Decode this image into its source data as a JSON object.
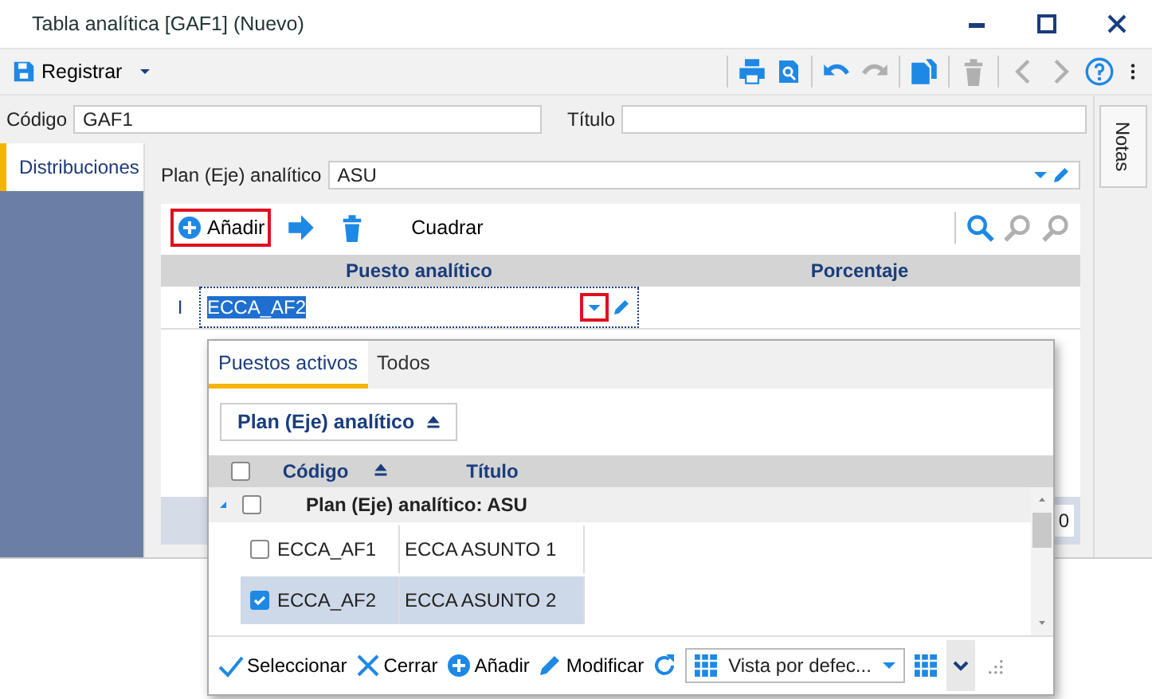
{
  "window": {
    "title": "Tabla analítica [GAF1] (Nuevo)"
  },
  "toolbar": {
    "save_label": "Registrar"
  },
  "header_fields": [
    {
      "label": "Código",
      "value": "GAF1"
    },
    {
      "label": "Título"
    }
  ],
  "side_tabs": [
    {
      "label": "Distribuciones",
      "selected": true
    }
  ],
  "notes_tab": {
    "label": "Notas"
  },
  "plan_field": {
    "label": "Plan (Eje) analítico",
    "value": "ASU"
  },
  "grid_toolbar": [
    {
      "kind": "add",
      "label": "Añadir",
      "highlighted": true
    },
    {
      "kind": "move",
      "highlighted": false
    },
    {
      "kind": "delete",
      "highlighted": false
    },
    {
      "kind": "text",
      "label": "Cuadrar",
      "highlighted": false
    }
  ],
  "grid": {
    "columns": [
      "Puesto analítico",
      "Porcentaje"
    ],
    "editing_row": {
      "marker": "I",
      "value": "ECCA_AF2",
      "dropdown_highlighted": true
    },
    "total": "0"
  },
  "popup": {
    "tabs": [
      {
        "label": "Puestos activos",
        "selected": true
      },
      {
        "label": "Todos",
        "selected": false
      }
    ],
    "group_by": "Plan (Eje) analítico",
    "select_all_checked": false,
    "columns": [
      {
        "label": "Código",
        "sorted": true
      },
      {
        "label": "Título",
        "sorted": false
      }
    ],
    "groups": [
      {
        "label": "Plan (Eje) analítico: ASU",
        "expanded": true,
        "checked": false,
        "rows": [
          {
            "code": "ECCA_AF1",
            "title": "ECCA ASUNTO 1",
            "checked": false,
            "selected": false
          },
          {
            "code": "ECCA_AF2",
            "title": "ECCA ASUNTO 2",
            "checked": true,
            "selected": true
          }
        ]
      }
    ],
    "actions": [
      {
        "kind": "select",
        "label": "Seleccionar"
      },
      {
        "kind": "close",
        "label": "Cerrar"
      },
      {
        "kind": "add",
        "label": "Añadir"
      },
      {
        "kind": "edit",
        "label": "Modificar"
      },
      {
        "kind": "refresh"
      }
    ],
    "view": "Vista por defec..."
  }
}
